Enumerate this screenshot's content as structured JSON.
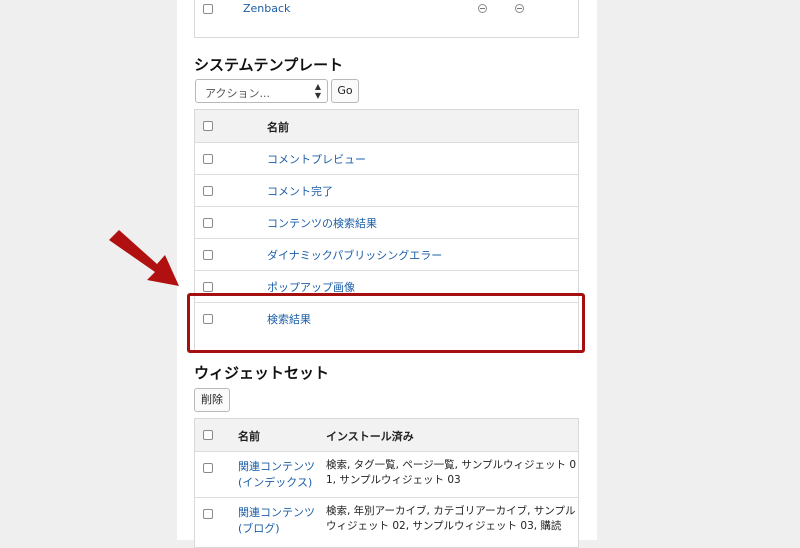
{
  "top_table": {
    "row_label": "Zenback"
  },
  "system_templates": {
    "title": "システムテンプレート",
    "action_select": "アクション...",
    "go_label": "Go",
    "header_name": "名前",
    "rows": [
      "コメントプレビュー",
      "コメント完了",
      "コンテンツの検索結果",
      "ダイナミックパブリッシングエラー",
      "ポップアップ画像",
      "検索結果"
    ]
  },
  "widget_sets": {
    "title": "ウィジェットセット",
    "delete_label": "削除",
    "header_name": "名前",
    "header_installed": "インストール済み",
    "rows": [
      {
        "name_line1": "関連コンテンツ",
        "name_line2": "(インデックス)",
        "installed_line1": "検索, タグ一覧, ページ一覧, サンプルウィジェット 0",
        "installed_line2": "1, サンプルウィジェット 03"
      },
      {
        "name_line1": "関連コンテンツ",
        "name_line2": "(ブログ)",
        "installed_line1": "検索, 年別アーカイブ, カテゴリアーカイブ, サンプル",
        "installed_line2": "ウィジェット 02, サンプルウィジェット 03, 購読"
      }
    ]
  },
  "annotation": {
    "arrow_color": "#b01010",
    "highlight_color": "#a40f0f"
  }
}
